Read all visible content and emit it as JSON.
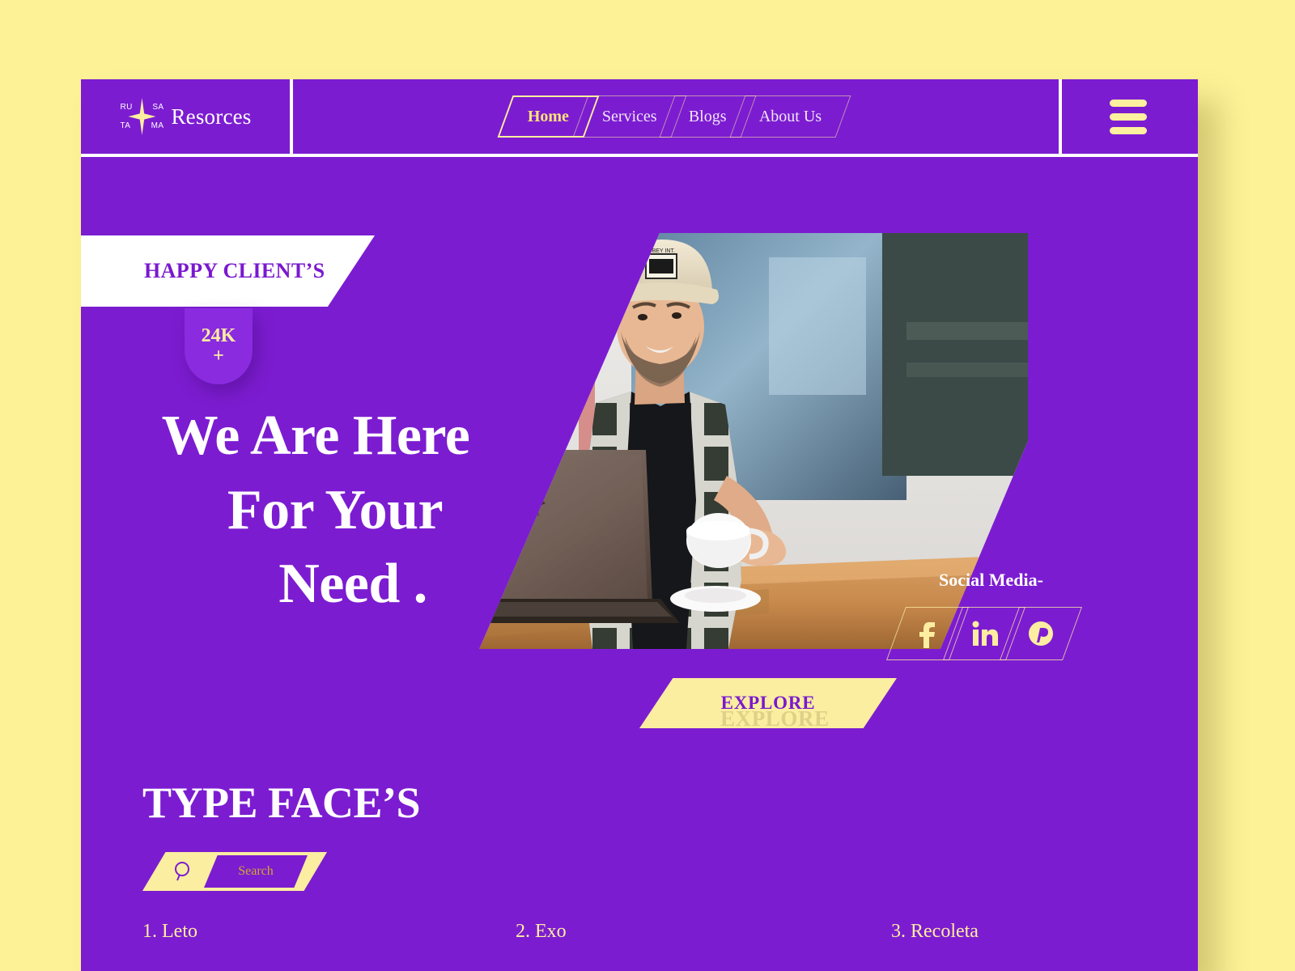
{
  "theme": {
    "page_bg": "#fdf296",
    "card_bg": "#7c1cd1",
    "accent_yellow": "#fdf09e",
    "accent_cream": "#fbeea0",
    "text_white": "#ffffff",
    "purple_text": "#7a19cf"
  },
  "header": {
    "logo": {
      "mark_name": "four-point-star",
      "abbr_top_left": "RU",
      "abbr_top_right": "SA",
      "abbr_bottom_left": "TA",
      "abbr_bottom_right": "MA",
      "wordmark": "Resorces"
    },
    "nav": [
      {
        "label": "Home",
        "active": true
      },
      {
        "label": "Services",
        "active": false
      },
      {
        "label": "Blogs",
        "active": false
      },
      {
        "label": "About Us",
        "active": false
      }
    ],
    "menu_button_name": "hamburger-menu"
  },
  "hero": {
    "banner_label": "HAPPY CLIENT’S",
    "stat_value": "24K",
    "stat_suffix": "+",
    "headline_line1": "We Are Here",
    "headline_line2": "For Your",
    "headline_line3": "Need .",
    "image_alt": "man in beige cap working on a laptop with a coffee cup",
    "cta_label": "EXPLORE",
    "cta_ghost_label": "EXPLORE"
  },
  "social": {
    "label": "Social Media-",
    "items": [
      {
        "name": "facebook-icon",
        "glyph": "f"
      },
      {
        "name": "linkedin-icon",
        "glyph": "in"
      },
      {
        "name": "pinterest-icon",
        "glyph": "P"
      }
    ]
  },
  "typefaces": {
    "title": "TYPE FACE’S",
    "search_placeholder": "Search",
    "search_value": "",
    "search_icon": "magnifier-icon",
    "items": [
      {
        "label": "1. Leto"
      },
      {
        "label": "2. Exo"
      },
      {
        "label": "3. Recoleta"
      }
    ]
  }
}
